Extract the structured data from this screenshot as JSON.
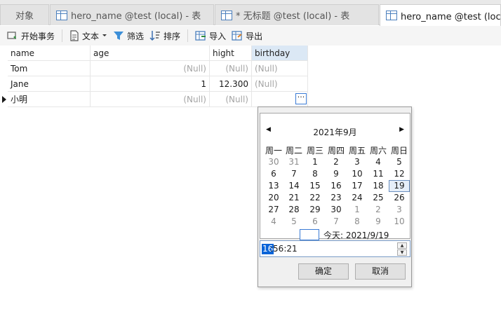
{
  "tabs": [
    {
      "label": "对象",
      "icon": ""
    },
    {
      "label": "hero_name @test (local) - 表",
      "icon": "table-edit-icon"
    },
    {
      "label": "* 无标题 @test (local) - 表",
      "icon": "table-edit-icon"
    },
    {
      "label": "hero_name @test (local) - 表",
      "icon": "table-icon",
      "active": true
    }
  ],
  "toolbar": {
    "begin_transaction": "开始事务",
    "text": "文本",
    "filter": "筛选",
    "sort": "排序",
    "import": "导入",
    "export": "导出"
  },
  "grid": {
    "columns": [
      "name",
      "age",
      "hight",
      "birthday"
    ],
    "rows": [
      [
        "Tom",
        "(Null)",
        "(Null)",
        "(Null)"
      ],
      [
        "Jane",
        "1",
        "12.300",
        "(Null)"
      ],
      [
        "小明",
        "(Null)",
        "(Null)",
        ""
      ]
    ],
    "ellipsis": "···"
  },
  "datepicker": {
    "month_title": "2021年9月",
    "weekdays": [
      "周一",
      "周二",
      "周三",
      "周四",
      "周五",
      "周六",
      "周日"
    ],
    "weeks": [
      [
        "30",
        "31",
        "1",
        "2",
        "3",
        "4",
        "5"
      ],
      [
        "6",
        "7",
        "8",
        "9",
        "10",
        "11",
        "12"
      ],
      [
        "13",
        "14",
        "15",
        "16",
        "17",
        "18",
        "19"
      ],
      [
        "20",
        "21",
        "22",
        "23",
        "24",
        "25",
        "26"
      ],
      [
        "27",
        "28",
        "29",
        "30",
        "1",
        "2",
        "3"
      ],
      [
        "4",
        "5",
        "6",
        "7",
        "8",
        "9",
        "10"
      ]
    ],
    "selected_day": "19",
    "today_label": "今天: 2021/9/19",
    "time_highlight": "16",
    "time_rest": ":56:21",
    "ok_label": "确定",
    "cancel_label": "取消"
  },
  "colors": {
    "accent": "#0a64d8",
    "selected_header": "#dbe8f5"
  }
}
